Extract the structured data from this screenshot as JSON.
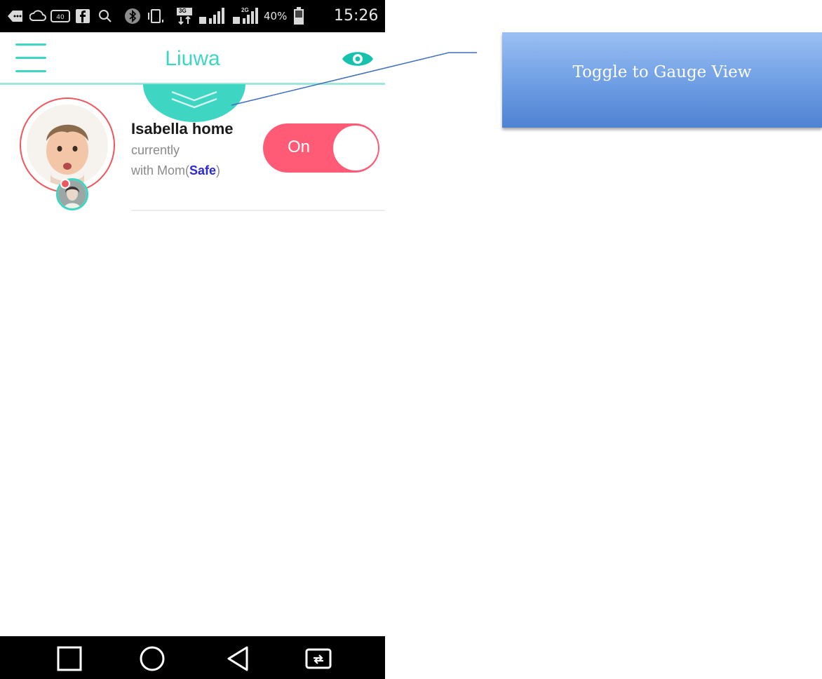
{
  "status_bar": {
    "battery_percent": "40%",
    "time": "15:26",
    "network_badge_1": "3G",
    "network_badge_2": "2G",
    "icons": [
      "back-icon",
      "cloud-icon",
      "badge-40-icon",
      "facebook-icon",
      "search-icon",
      "bluetooth-icon",
      "vibrate-icon",
      "data-transfer-icon",
      "signal-icon",
      "signal-icon",
      "battery-icon"
    ],
    "badge_40": "40"
  },
  "app_bar": {
    "title": "Liuwa",
    "accent_color": "#3fd5c3"
  },
  "child_card": {
    "name": "Isabella home",
    "status_line1": "currently",
    "status_line2_prefix": "with Mom(",
    "status_safe": "Safe",
    "status_line2_suffix": ")",
    "toggle_label": "On",
    "toggle_color": "#ff5a76"
  },
  "nav_bar": {
    "buttons": [
      "recents-icon",
      "home-icon",
      "back-icon",
      "dual-window-icon"
    ]
  },
  "callout": {
    "text": "Toggle to Gauge View"
  }
}
